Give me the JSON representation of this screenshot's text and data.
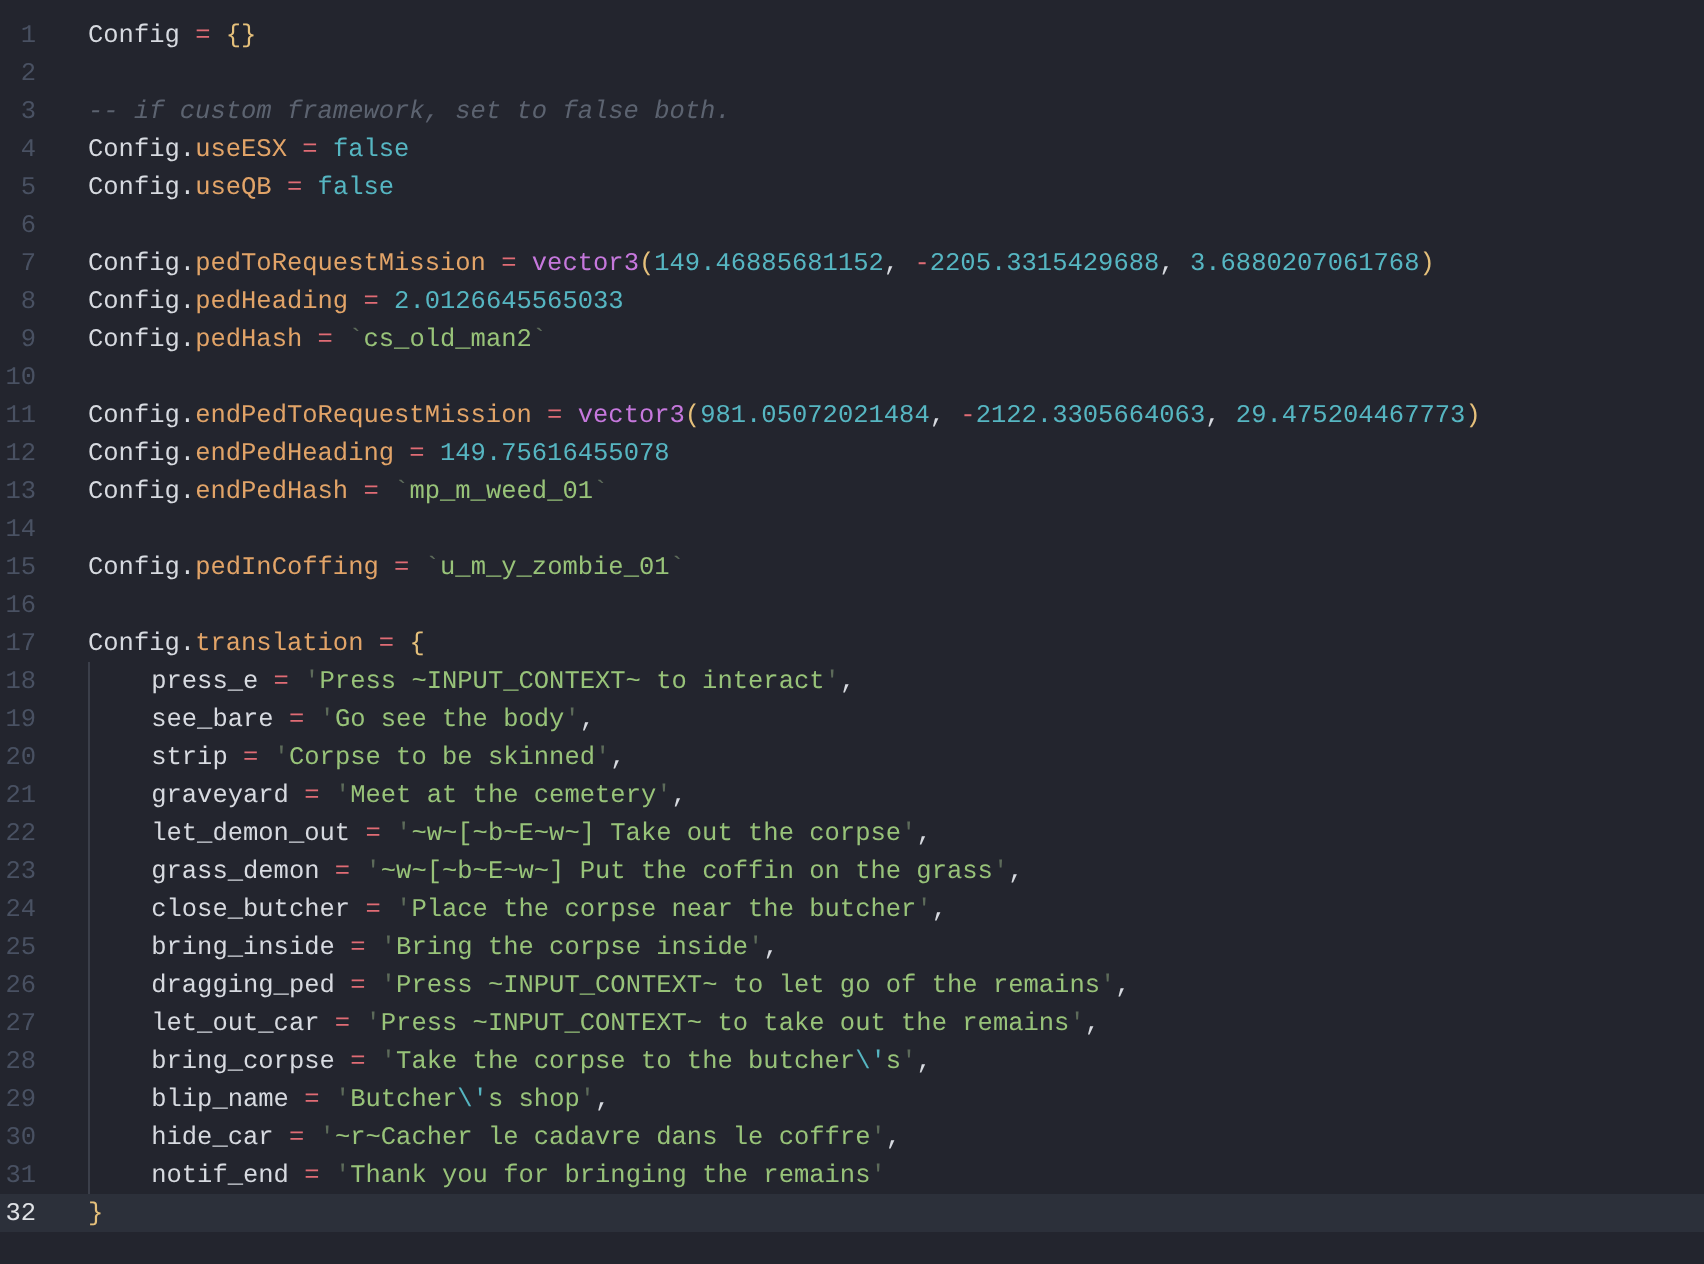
{
  "editor": {
    "lines": [
      {
        "number": "1",
        "current": false,
        "tokens": [
          {
            "kind": "plain",
            "text": "Config"
          },
          {
            "kind": "op",
            "text": " = "
          },
          {
            "kind": "bracket",
            "text": "{}"
          }
        ]
      },
      {
        "number": "2",
        "current": false
      },
      {
        "number": "3",
        "current": false,
        "tokens": [
          {
            "kind": "comment",
            "text": "-- if custom framework, set to false both."
          }
        ]
      },
      {
        "number": "4",
        "current": false,
        "tokens": [
          {
            "kind": "plain",
            "text": "Config."
          },
          {
            "kind": "prop",
            "text": "useESX"
          },
          {
            "kind": "op",
            "text": " = "
          },
          {
            "kind": "num",
            "text": "false"
          }
        ]
      },
      {
        "number": "5",
        "current": false,
        "tokens": [
          {
            "kind": "plain",
            "text": "Config."
          },
          {
            "kind": "prop",
            "text": "useQB"
          },
          {
            "kind": "op",
            "text": " = "
          },
          {
            "kind": "num",
            "text": "false"
          }
        ]
      },
      {
        "number": "6",
        "current": false
      },
      {
        "number": "7",
        "current": false,
        "tokens": [
          {
            "kind": "plain",
            "text": "Config."
          },
          {
            "kind": "prop",
            "text": "pedToRequestMission"
          },
          {
            "kind": "op",
            "text": " = "
          },
          {
            "kind": "fn",
            "text": "vector3"
          },
          {
            "kind": "bracket",
            "text": "("
          },
          {
            "kind": "num",
            "text": "149.46885681152"
          },
          {
            "kind": "plain",
            "text": ", "
          },
          {
            "kind": "op",
            "text": "-"
          },
          {
            "kind": "num",
            "text": "2205.3315429688"
          },
          {
            "kind": "plain",
            "text": ", "
          },
          {
            "kind": "num",
            "text": "3.6880207061768"
          },
          {
            "kind": "bracket",
            "text": ")"
          }
        ]
      },
      {
        "number": "8",
        "current": false,
        "tokens": [
          {
            "kind": "plain",
            "text": "Config."
          },
          {
            "kind": "prop",
            "text": "pedHeading"
          },
          {
            "kind": "op",
            "text": " = "
          },
          {
            "kind": "num",
            "text": "2.0126645565033"
          }
        ]
      },
      {
        "number": "9",
        "current": false,
        "tokens": [
          {
            "kind": "plain",
            "text": "Config."
          },
          {
            "kind": "prop",
            "text": "pedHash"
          },
          {
            "kind": "op",
            "text": " = "
          },
          {
            "kind": "quote",
            "text": "`"
          },
          {
            "kind": "str",
            "text": "cs_old_man2"
          },
          {
            "kind": "quote",
            "text": "`"
          }
        ]
      },
      {
        "number": "10",
        "current": false
      },
      {
        "number": "11",
        "current": false,
        "tokens": [
          {
            "kind": "plain",
            "text": "Config."
          },
          {
            "kind": "prop",
            "text": "endPedToRequestMission"
          },
          {
            "kind": "op",
            "text": " = "
          },
          {
            "kind": "fn",
            "text": "vector3"
          },
          {
            "kind": "bracket",
            "text": "("
          },
          {
            "kind": "num",
            "text": "981.05072021484"
          },
          {
            "kind": "plain",
            "text": ", "
          },
          {
            "kind": "op",
            "text": "-"
          },
          {
            "kind": "num",
            "text": "2122.3305664063"
          },
          {
            "kind": "plain",
            "text": ", "
          },
          {
            "kind": "num",
            "text": "29.475204467773"
          },
          {
            "kind": "bracket",
            "text": ")"
          }
        ]
      },
      {
        "number": "12",
        "current": false,
        "tokens": [
          {
            "kind": "plain",
            "text": "Config."
          },
          {
            "kind": "prop",
            "text": "endPedHeading"
          },
          {
            "kind": "op",
            "text": " = "
          },
          {
            "kind": "num",
            "text": "149.75616455078"
          }
        ]
      },
      {
        "number": "13",
        "current": false,
        "tokens": [
          {
            "kind": "plain",
            "text": "Config."
          },
          {
            "kind": "prop",
            "text": "endPedHash"
          },
          {
            "kind": "op",
            "text": " = "
          },
          {
            "kind": "quote",
            "text": "`"
          },
          {
            "kind": "str",
            "text": "mp_m_weed_01"
          },
          {
            "kind": "quote",
            "text": "`"
          }
        ]
      },
      {
        "number": "14",
        "current": false
      },
      {
        "number": "15",
        "current": false,
        "tokens": [
          {
            "kind": "plain",
            "text": "Config."
          },
          {
            "kind": "prop",
            "text": "pedInCoffing"
          },
          {
            "kind": "op",
            "text": " = "
          },
          {
            "kind": "quote",
            "text": "`"
          },
          {
            "kind": "str",
            "text": "u_m_y_zombie_01"
          },
          {
            "kind": "quote",
            "text": "`"
          }
        ]
      },
      {
        "number": "16",
        "current": false
      },
      {
        "number": "17",
        "current": false,
        "tokens": [
          {
            "kind": "plain",
            "text": "Config."
          },
          {
            "kind": "prop",
            "text": "translation"
          },
          {
            "kind": "op",
            "text": " = "
          },
          {
            "kind": "bracket",
            "text": "{"
          }
        ],
        "children": [
          {
            "number": "18",
            "current": false,
            "tokens": [
              {
                "kind": "plain",
                "text": "press_e"
              },
              {
                "kind": "op",
                "text": " = "
              },
              {
                "kind": "quote",
                "text": "'"
              },
              {
                "kind": "str",
                "text": "Press ~INPUT_CONTEXT~ to interact"
              },
              {
                "kind": "quote",
                "text": "'"
              },
              {
                "kind": "plain",
                "text": ","
              }
            ]
          },
          {
            "number": "19",
            "current": false,
            "tokens": [
              {
                "kind": "plain",
                "text": "see_bare"
              },
              {
                "kind": "op",
                "text": " = "
              },
              {
                "kind": "quote",
                "text": "'"
              },
              {
                "kind": "str",
                "text": "Go see the body"
              },
              {
                "kind": "quote",
                "text": "'"
              },
              {
                "kind": "plain",
                "text": ","
              }
            ]
          },
          {
            "number": "20",
            "current": false,
            "tokens": [
              {
                "kind": "plain",
                "text": "strip"
              },
              {
                "kind": "op",
                "text": " = "
              },
              {
                "kind": "quote",
                "text": "'"
              },
              {
                "kind": "str",
                "text": "Corpse to be skinned"
              },
              {
                "kind": "quote",
                "text": "'"
              },
              {
                "kind": "plain",
                "text": ","
              }
            ]
          },
          {
            "number": "21",
            "current": false,
            "tokens": [
              {
                "kind": "plain",
                "text": "graveyard"
              },
              {
                "kind": "op",
                "text": " = "
              },
              {
                "kind": "quote",
                "text": "'"
              },
              {
                "kind": "str",
                "text": "Meet at the cemetery"
              },
              {
                "kind": "quote",
                "text": "'"
              },
              {
                "kind": "plain",
                "text": ","
              }
            ]
          },
          {
            "number": "22",
            "current": false,
            "tokens": [
              {
                "kind": "plain",
                "text": "let_demon_out"
              },
              {
                "kind": "op",
                "text": " = "
              },
              {
                "kind": "quote",
                "text": "'"
              },
              {
                "kind": "str",
                "text": "~w~[~b~E~w~] Take out the corpse"
              },
              {
                "kind": "quote",
                "text": "'"
              },
              {
                "kind": "plain",
                "text": ","
              }
            ]
          },
          {
            "number": "23",
            "current": false,
            "tokens": [
              {
                "kind": "plain",
                "text": "grass_demon"
              },
              {
                "kind": "op",
                "text": " = "
              },
              {
                "kind": "quote",
                "text": "'"
              },
              {
                "kind": "str",
                "text": "~w~[~b~E~w~] Put the coffin on the grass"
              },
              {
                "kind": "quote",
                "text": "'"
              },
              {
                "kind": "plain",
                "text": ","
              }
            ]
          },
          {
            "number": "24",
            "current": false,
            "tokens": [
              {
                "kind": "plain",
                "text": "close_butcher"
              },
              {
                "kind": "op",
                "text": " = "
              },
              {
                "kind": "quote",
                "text": "'"
              },
              {
                "kind": "str",
                "text": "Place the corpse near the butcher"
              },
              {
                "kind": "quote",
                "text": "'"
              },
              {
                "kind": "plain",
                "text": ","
              }
            ]
          },
          {
            "number": "25",
            "current": false,
            "tokens": [
              {
                "kind": "plain",
                "text": "bring_inside"
              },
              {
                "kind": "op",
                "text": " = "
              },
              {
                "kind": "quote",
                "text": "'"
              },
              {
                "kind": "str",
                "text": "Bring the corpse inside"
              },
              {
                "kind": "quote",
                "text": "'"
              },
              {
                "kind": "plain",
                "text": ","
              }
            ]
          },
          {
            "number": "26",
            "current": false,
            "tokens": [
              {
                "kind": "plain",
                "text": "dragging_ped"
              },
              {
                "kind": "op",
                "text": " = "
              },
              {
                "kind": "quote",
                "text": "'"
              },
              {
                "kind": "str",
                "text": "Press ~INPUT_CONTEXT~ to let go of the remains"
              },
              {
                "kind": "quote",
                "text": "'"
              },
              {
                "kind": "plain",
                "text": ","
              }
            ]
          },
          {
            "number": "27",
            "current": false,
            "tokens": [
              {
                "kind": "plain",
                "text": "let_out_car"
              },
              {
                "kind": "op",
                "text": " = "
              },
              {
                "kind": "quote",
                "text": "'"
              },
              {
                "kind": "str",
                "text": "Press ~INPUT_CONTEXT~ to take out the remains"
              },
              {
                "kind": "quote",
                "text": "'"
              },
              {
                "kind": "plain",
                "text": ","
              }
            ]
          },
          {
            "number": "28",
            "current": false,
            "tokens": [
              {
                "kind": "plain",
                "text": "bring_corpse"
              },
              {
                "kind": "op",
                "text": " = "
              },
              {
                "kind": "quote",
                "text": "'"
              },
              {
                "kind": "str",
                "text": "Take the corpse to the butcher"
              },
              {
                "kind": "escape",
                "text": "\\'"
              },
              {
                "kind": "str",
                "text": "s"
              },
              {
                "kind": "quote",
                "text": "'"
              },
              {
                "kind": "plain",
                "text": ","
              }
            ]
          },
          {
            "number": "29",
            "current": false,
            "tokens": [
              {
                "kind": "plain",
                "text": "blip_name"
              },
              {
                "kind": "op",
                "text": " = "
              },
              {
                "kind": "quote",
                "text": "'"
              },
              {
                "kind": "str",
                "text": "Butcher"
              },
              {
                "kind": "escape",
                "text": "\\'"
              },
              {
                "kind": "str",
                "text": "s shop"
              },
              {
                "kind": "quote",
                "text": "'"
              },
              {
                "kind": "plain",
                "text": ","
              }
            ]
          },
          {
            "number": "30",
            "current": false,
            "tokens": [
              {
                "kind": "plain",
                "text": "hide_car"
              },
              {
                "kind": "op",
                "text": " = "
              },
              {
                "kind": "quote",
                "text": "'"
              },
              {
                "kind": "str",
                "text": "~r~Cacher le cadavre dans le coffre"
              },
              {
                "kind": "quote",
                "text": "'"
              },
              {
                "kind": "plain",
                "text": ","
              }
            ]
          },
          {
            "number": "31",
            "current": false,
            "tokens": [
              {
                "kind": "plain",
                "text": "notif_end"
              },
              {
                "kind": "op",
                "text": " = "
              },
              {
                "kind": "quote",
                "text": "'"
              },
              {
                "kind": "str",
                "text": "Thank you for bringing the remains"
              },
              {
                "kind": "quote",
                "text": "'"
              }
            ]
          }
        ]
      },
      {
        "number": "32",
        "current": true,
        "tokens": [
          {
            "kind": "bracket",
            "text": "}"
          }
        ]
      }
    ]
  }
}
